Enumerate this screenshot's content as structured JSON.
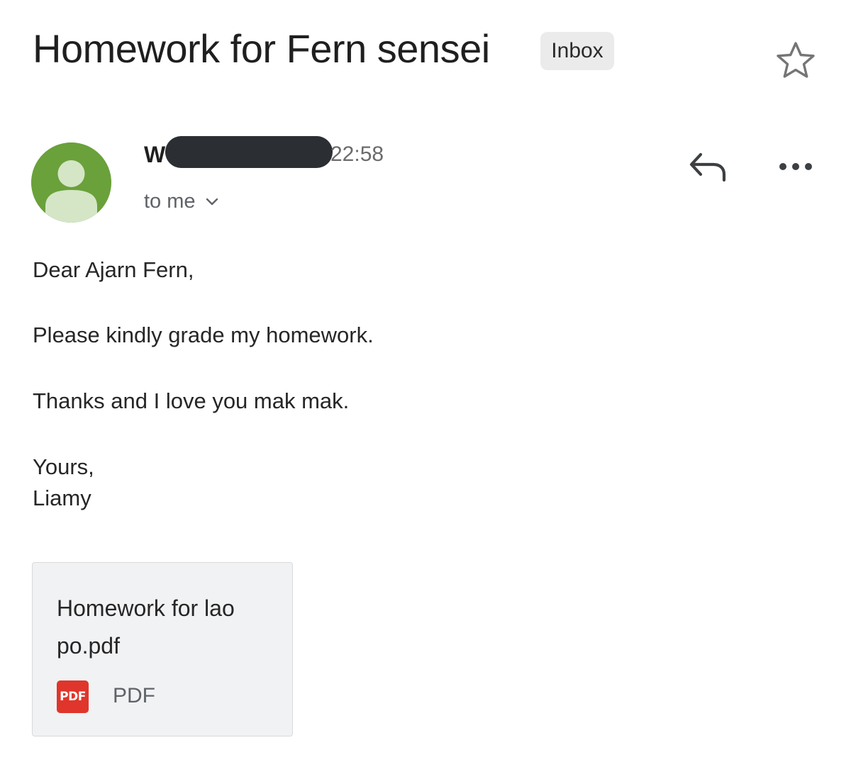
{
  "header": {
    "subject": "Homework for Fern sensei",
    "label": "Inbox",
    "star_icon": "star-outline-icon"
  },
  "message": {
    "sender_initial": "W",
    "sender_redacted": true,
    "time": "22:58",
    "recipient_label": "to me",
    "recipient_icon": "chevron-down-icon",
    "actions": {
      "reply_icon": "reply-icon",
      "more_icon": "more-horizontal-icon"
    },
    "avatar": {
      "icon": "default-person-avatar",
      "color": "#6aa13a"
    },
    "body": {
      "greeting": "Dear Ajarn Fern,",
      "line1": "Please kindly grade my homework.",
      "line2": "Thanks and I love you mak mak.",
      "closing": "Yours,",
      "signature": "Liamy"
    }
  },
  "attachment": {
    "filename": "Homework for lao po.pdf",
    "icon_text": "PDF",
    "type_label": "PDF",
    "icon_color": "#e0352b"
  }
}
